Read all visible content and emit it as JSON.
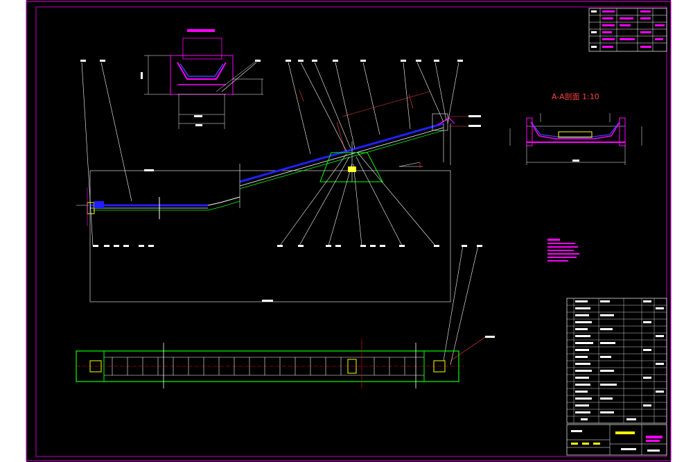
{
  "colors": {
    "frame": "#c000c0",
    "leader": "#ffffff",
    "belt": "#2020ff",
    "structure": "#ff00ff",
    "support": "#00ff00",
    "centerline": "#ff0000",
    "hopper": "#ffff00"
  },
  "section_view": {
    "title": "A-A剖面 1:10"
  }
}
